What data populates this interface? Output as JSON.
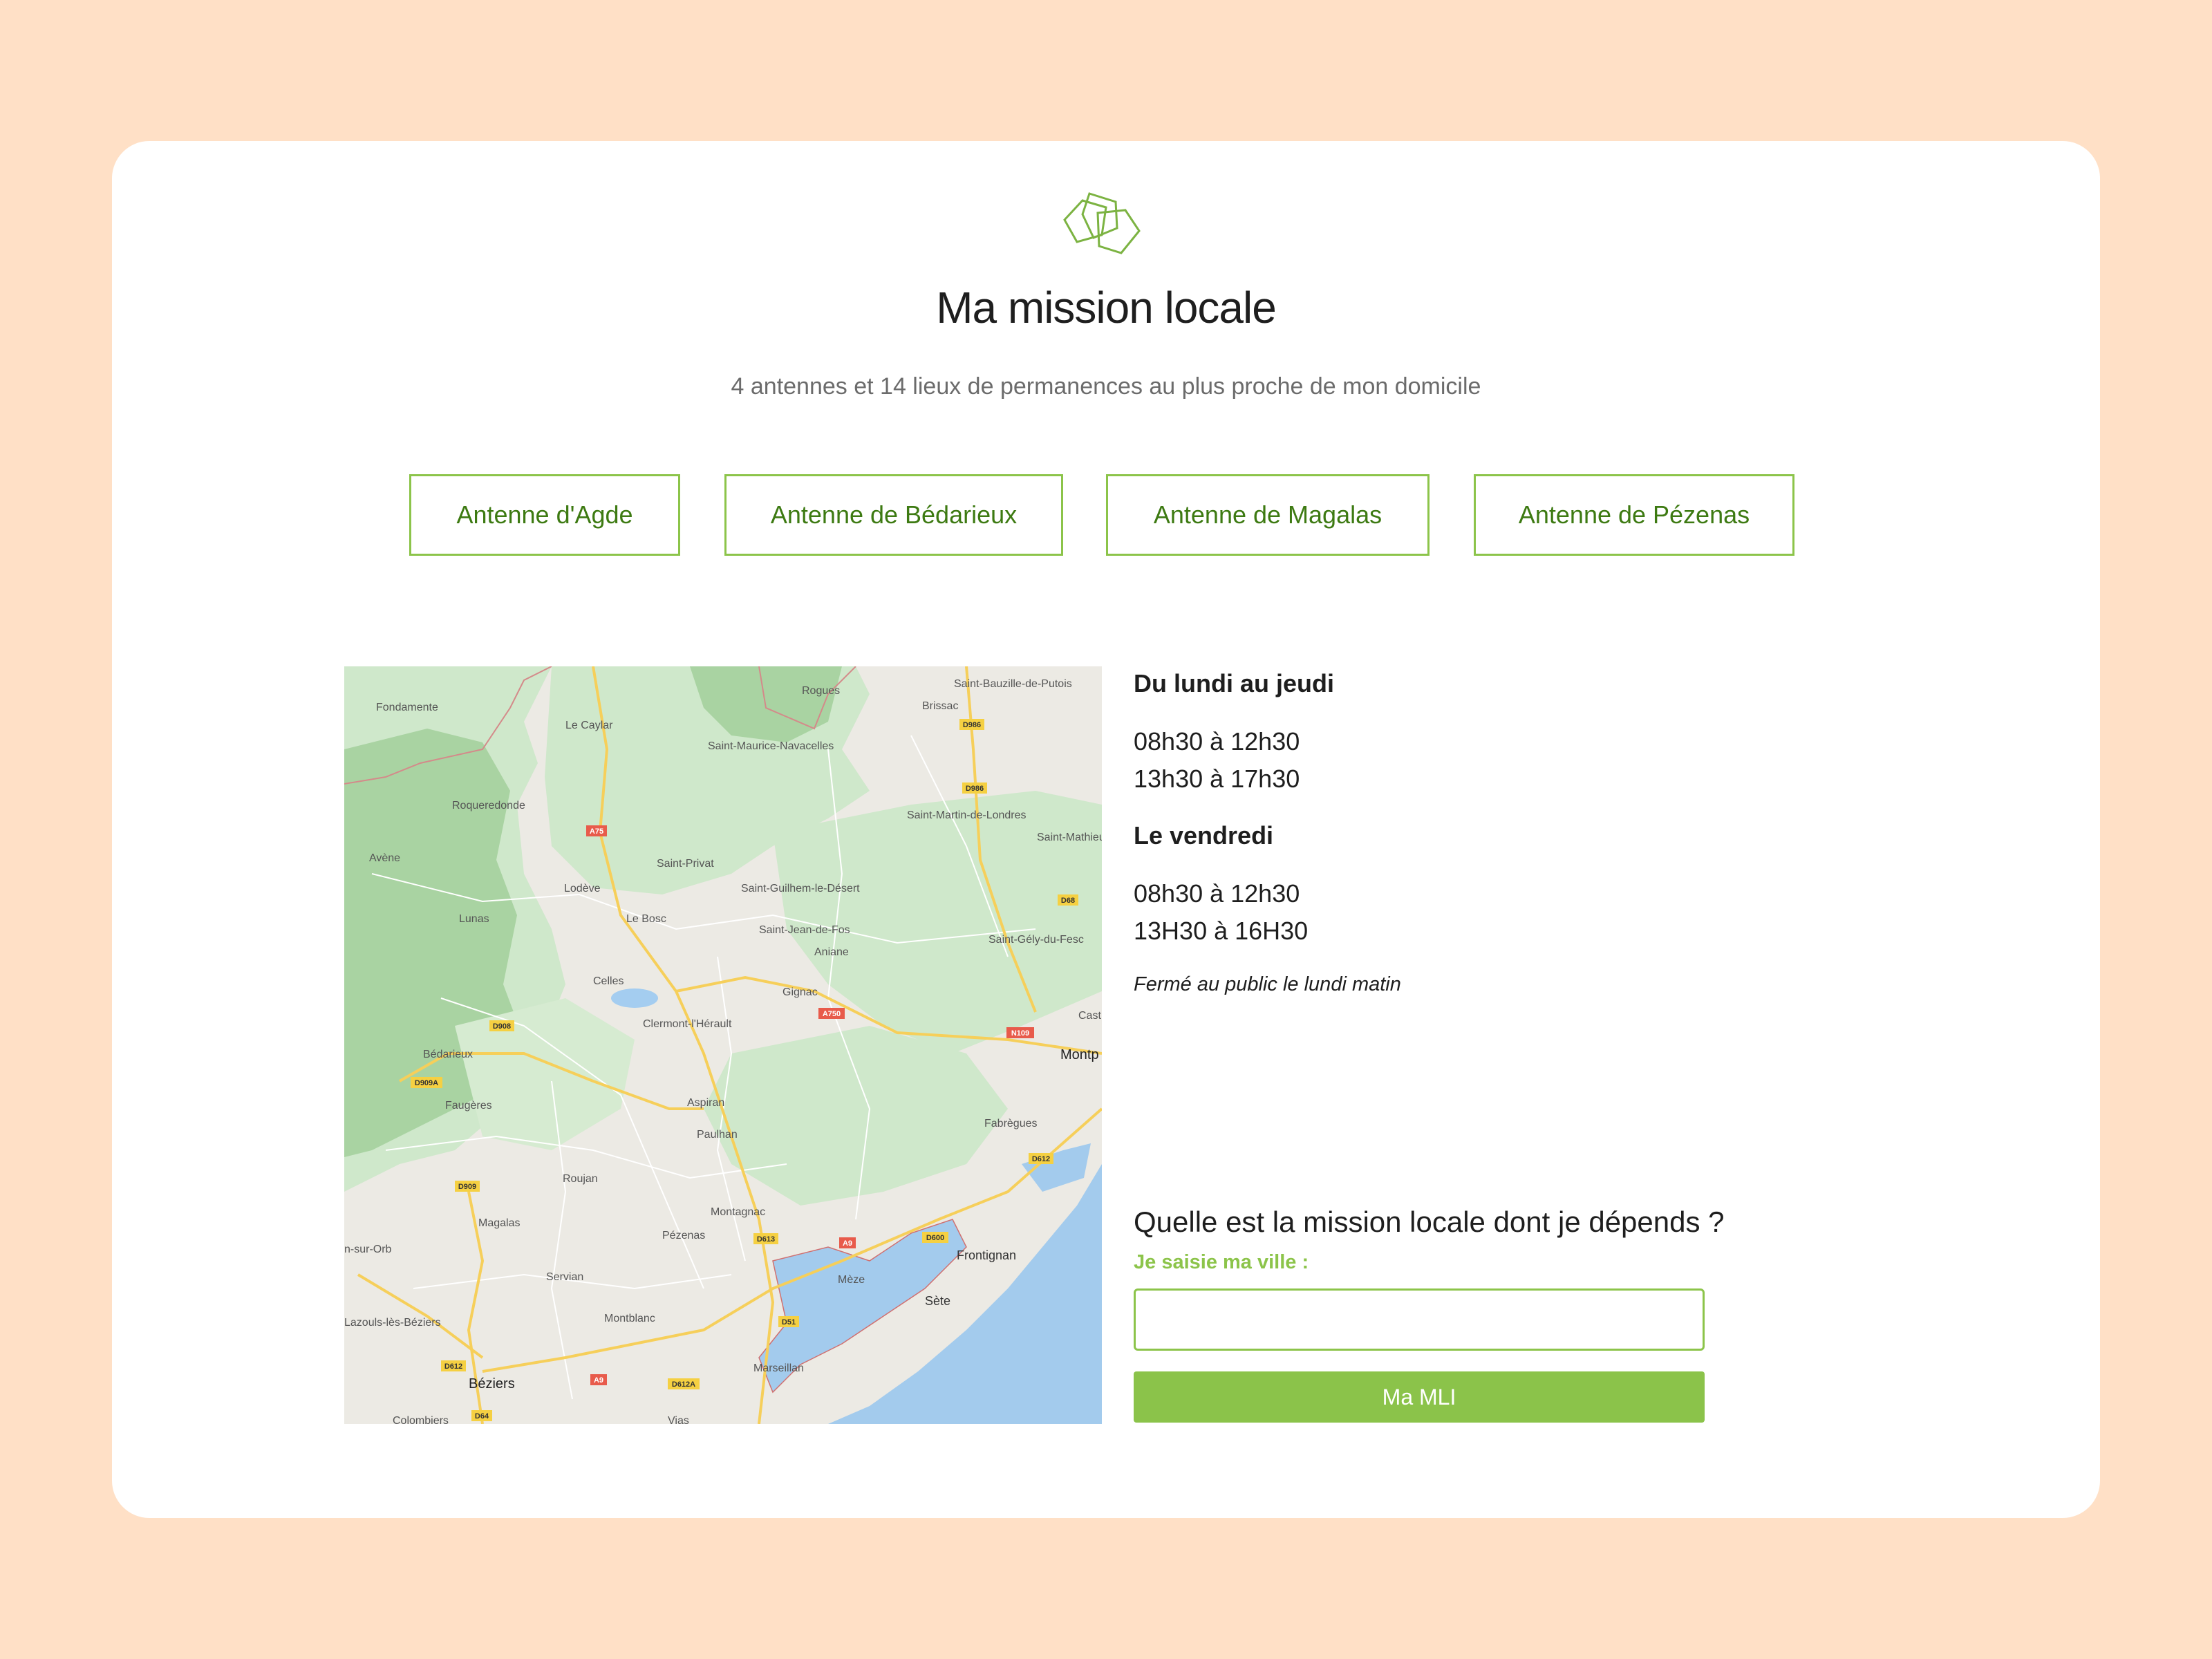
{
  "header": {
    "logo_icon": "pentagons-logo-icon",
    "title": "Ma mission locale",
    "subtitle": "4 antennes et 14 lieux de permanences au plus proche de mon domicile"
  },
  "antennas": [
    {
      "label": "Antenne d'Agde"
    },
    {
      "label": "Antenne de Bédarieux"
    },
    {
      "label": "Antenne de Magalas"
    },
    {
      "label": "Antenne de Pézenas"
    }
  ],
  "map": {
    "labels": {
      "fondamente": "Fondamente",
      "le_caylar": "Le Caylar",
      "rogues": "Rogues",
      "saint_bauzille": "Saint-Bauzille-de-Putois",
      "brissac": "Brissac",
      "saint_maurice": "Saint-Maurice-Navacelles",
      "roqueredonde": "Roqueredonde",
      "saint_martin": "Saint-Martin-de-Londres",
      "avene": "Avène",
      "saint_privat": "Saint-Privat",
      "saint_mathieu": "Saint-Mathieu",
      "lodeve": "Lodève",
      "saint_guilhem": "Saint-Guilhem-le-Désert",
      "lunas": "Lunas",
      "le_bosc": "Le Bosc",
      "saint_jean": "Saint-Jean-de-Fos",
      "saint_gely": "Saint-Gély-du-Fesc",
      "aniane": "Aniane",
      "celles": "Celles",
      "gignac": "Gignac",
      "clermont": "Clermont-l'Hérault",
      "castelnau": "Cast",
      "bedarieux": "Bédarieux",
      "montpellier": "Montp",
      "faugeres": "Faugères",
      "aspiran": "Aspiran",
      "fabregues": "Fabrègues",
      "paulhan": "Paulhan",
      "roujan": "Roujan",
      "montagnac": "Montagnac",
      "magalas": "Magalas",
      "pezenas": "Pézenas",
      "frontignan": "Frontignan",
      "st_chinian": "n-sur-Orb",
      "servian": "Servian",
      "meze": "Mèze",
      "sete": "Sète",
      "lazouls": "Lazouls-lès-Béziers",
      "montblanc": "Montblanc",
      "marseillan": "Marseillan",
      "beziers": "Béziers",
      "colombiers": "Colombiers",
      "vias": "Vias"
    },
    "road_badges": {
      "a75": "A75",
      "d986a": "D986",
      "d986b": "D986",
      "d68": "D68",
      "a750": "A750",
      "n109": "N109",
      "d908": "D908",
      "d909a": "D909A",
      "d909": "D909",
      "d612a": "D612",
      "d613": "D613",
      "a9a": "A9",
      "d600": "D600",
      "d51": "D51",
      "d612b": "D612",
      "a9b": "A9",
      "d612a2": "D612A",
      "d64": "D64"
    }
  },
  "hours": {
    "weekdays_heading": "Du lundi au jeudi",
    "weekdays_morning": "08h30 à 12h30",
    "weekdays_afternoon": "13h30 à 17h30",
    "friday_heading": "Le vendredi",
    "friday_morning": "08h30 à 12h30",
    "friday_afternoon": "13H30 à 16H30",
    "closed_note": "Fermé au public le lundi matin"
  },
  "finder": {
    "question": "Quelle est la mission locale dont je dépends ?",
    "city_label": "Je saisie ma ville :",
    "city_value": "",
    "submit_label": "Ma MLI"
  },
  "colors": {
    "background": "#ffe0c6",
    "accent_green": "#8bc34a",
    "button_text_green": "#3d7a12",
    "card": "#ffffff"
  }
}
